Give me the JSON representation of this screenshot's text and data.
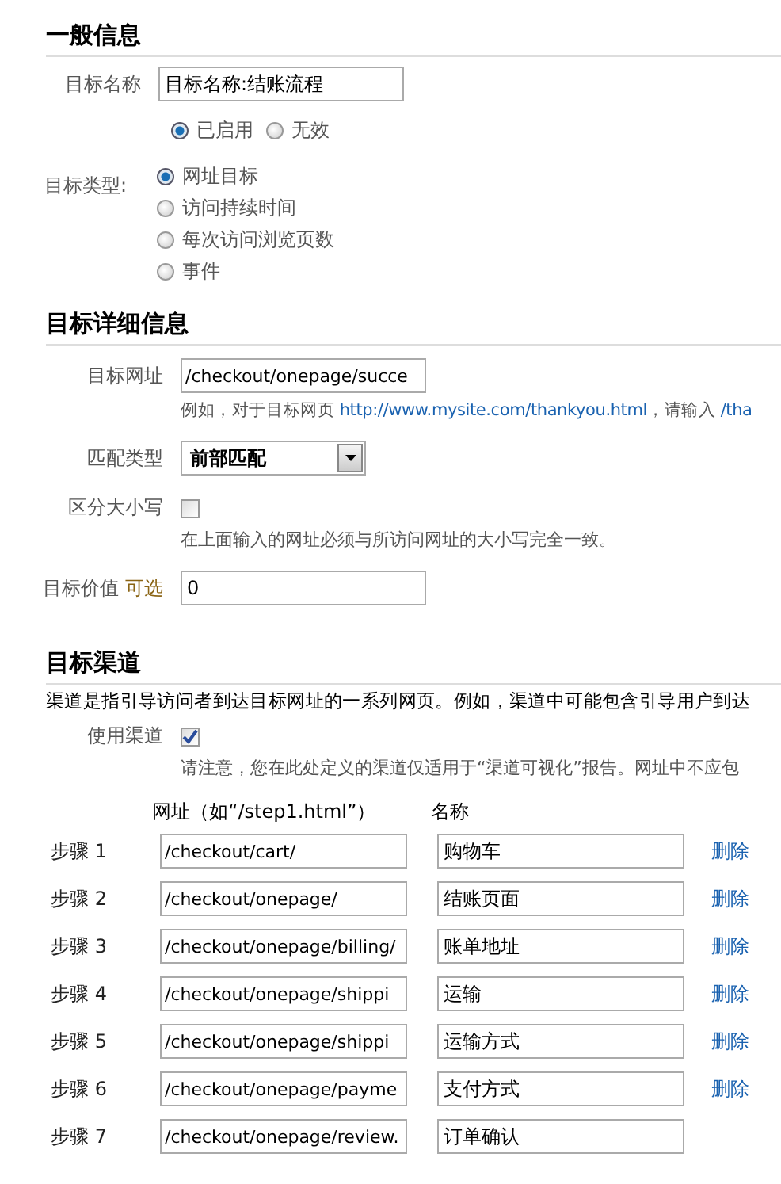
{
  "general": {
    "title": "一般信息",
    "name_field": {
      "label": "目标名称",
      "value": "目标名称:结账流程"
    },
    "status_options": [
      {
        "label": "已启用",
        "selected": true
      },
      {
        "label": "无效",
        "selected": false
      }
    ],
    "goal_type": {
      "label": "目标类型:",
      "options": [
        {
          "label": "网址目标",
          "selected": true
        },
        {
          "label": "访问持续时间",
          "selected": false
        },
        {
          "label": "每次访问浏览页数",
          "selected": false
        },
        {
          "label": "事件",
          "selected": false
        }
      ]
    }
  },
  "details": {
    "title": "目标详细信息",
    "url_field": {
      "label": "目标网址",
      "value": "/checkout/onepage/succe",
      "hint": [
        {
          "kind": "text",
          "text": "例如，对于目标网页 "
        },
        {
          "kind": "link",
          "text": "http://www.mysite.com/thankyou.html"
        },
        {
          "kind": "text",
          "text": "，请输入 "
        },
        {
          "kind": "link",
          "text": "/tha"
        }
      ]
    },
    "match_type": {
      "label": "匹配类型",
      "value": "前部匹配"
    },
    "case_sensitive": {
      "label": "区分大小写",
      "checked": false,
      "hint": "在上面输入的网址必须与所访问网址的大小写完全一致。"
    },
    "goal_value": {
      "label": "目标价值",
      "optional": "可选",
      "value": "0"
    }
  },
  "funnel": {
    "title": "目标渠道",
    "description": "渠道是指引导访问者到达目标网址的一系列网页。例如，渠道中可能包含引导用户到达",
    "use_funnel": {
      "label": "使用渠道",
      "checked": true,
      "note": "请注意，您在此处定义的渠道仅适用于“渠道可视化”报告。网址中不应包"
    },
    "columns": [
      "网址（如“/step1.html”）",
      "名称"
    ],
    "steps": [
      {
        "label": "步骤 1",
        "url": "/checkout/cart/",
        "name": "购物车",
        "delete": "删除"
      },
      {
        "label": "步骤 2",
        "url": "/checkout/onepage/",
        "name": "结账页面",
        "delete": "删除"
      },
      {
        "label": "步骤 3",
        "url": "/checkout/onepage/billing/",
        "name": "账单地址",
        "delete": "删除"
      },
      {
        "label": "步骤 4",
        "url": "/checkout/onepage/shippi",
        "name": "运输",
        "delete": "删除"
      },
      {
        "label": "步骤 5",
        "url": "/checkout/onepage/shippi",
        "name": "运输方式",
        "delete": "删除"
      },
      {
        "label": "步骤 6",
        "url": "/checkout/onepage/payme",
        "name": "支付方式",
        "delete": "删除"
      },
      {
        "label": "步骤 7",
        "url": "/checkout/onepage/review.",
        "name": "订单确认"
      }
    ]
  }
}
